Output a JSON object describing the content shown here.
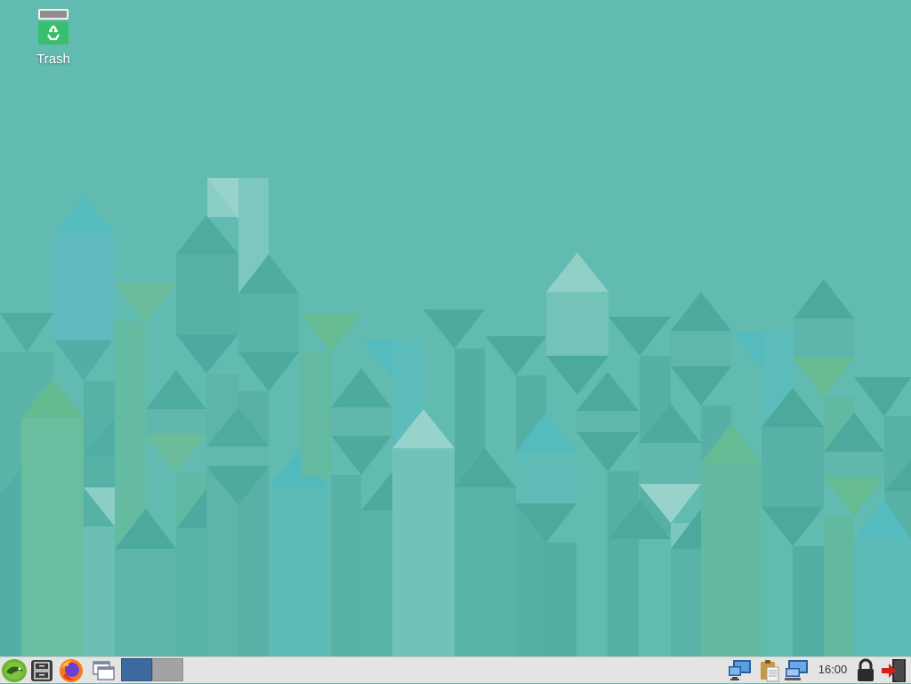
{
  "desktop": {
    "icons": [
      {
        "label": "Trash",
        "icon": "trash-icon"
      }
    ]
  },
  "taskbar": {
    "launchers": [
      {
        "name": "main-menu",
        "icon": "opensuse-chameleon-icon"
      },
      {
        "name": "file-manager",
        "icon": "file-cabinet-icon"
      },
      {
        "name": "web-browser",
        "icon": "firefox-icon"
      },
      {
        "name": "show-desktop",
        "icon": "windows-icon"
      }
    ],
    "pager": {
      "desktops": 2,
      "active": 1
    },
    "tray": [
      "network-icon",
      "clipboard-icon",
      "display-icon"
    ],
    "clock": "16:00",
    "actions": [
      "lock-icon",
      "logout-icon"
    ]
  },
  "colors": {
    "wallpaper_base": "#62bbb0",
    "taskbar": "#e4e4e4",
    "pager_active": "#3d6a9e",
    "pager_inactive": "#a3a3a3"
  }
}
